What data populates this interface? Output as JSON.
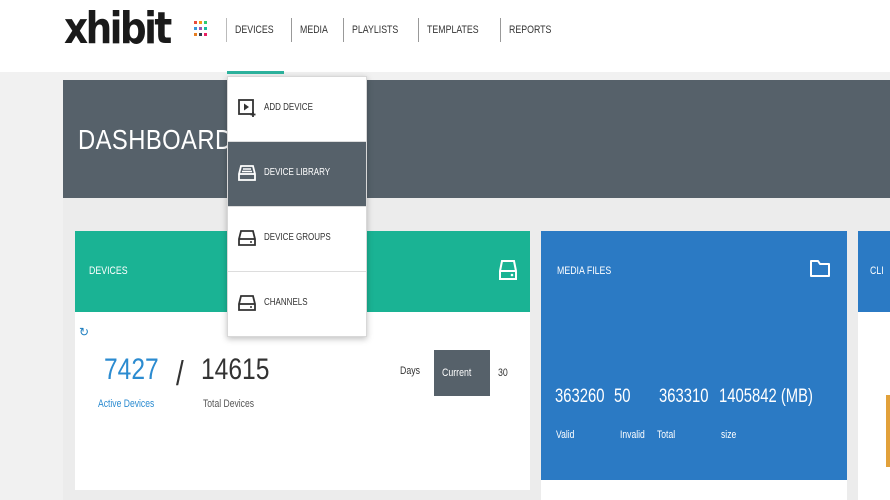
{
  "brand": {
    "logo_text": "xhibit"
  },
  "nav": {
    "items": [
      {
        "label": "DEVICES"
      },
      {
        "label": "MEDIA"
      },
      {
        "label": "PLAYLISTS"
      },
      {
        "label": "TEMPLATES"
      },
      {
        "label": "REPORTS"
      }
    ],
    "active": "DEVICES"
  },
  "dropdown": {
    "items": [
      {
        "label": "ADD DEVICE",
        "icon": "add-device-icon"
      },
      {
        "label": "DEVICE LIBRARY",
        "icon": "device-library-icon"
      },
      {
        "label": "DEVICE GROUPS",
        "icon": "device-groups-icon"
      },
      {
        "label": "CHANNELS",
        "icon": "channels-icon"
      }
    ],
    "active": "DEVICE LIBRARY"
  },
  "page": {
    "title": "DASHBOARD"
  },
  "devices_card": {
    "title": "DEVICES",
    "active_count": "7427",
    "slash": "/",
    "total_count": "14615",
    "active_label": "Active Devices",
    "total_label": "Total Devices",
    "days_label": "Days",
    "range_options": [
      "Current",
      "30"
    ],
    "selected_range": "Current"
  },
  "media_card": {
    "title": "MEDIA FILES",
    "stats": [
      {
        "value": "363260",
        "label": "Valid"
      },
      {
        "value": "50",
        "label": "Invalid"
      },
      {
        "value": "363310",
        "label": "Total"
      },
      {
        "value": "1405842 (MB)",
        "label": "size"
      }
    ]
  },
  "third_card": {
    "title": "CLI"
  },
  "colors": {
    "accent_teal": "#1ab394",
    "accent_blue": "#2b7ac4",
    "header_band": "#56616a",
    "active_number": "#2b8bd0"
  }
}
